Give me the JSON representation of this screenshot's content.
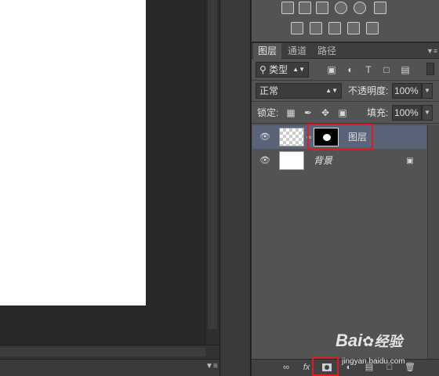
{
  "tabs": [
    {
      "label": "图层",
      "active": true
    },
    {
      "label": "通道",
      "active": false
    },
    {
      "label": "路径",
      "active": false
    }
  ],
  "filter": {
    "kind_label": "类型"
  },
  "blend": {
    "mode": "正常",
    "opacity_label": "不透明度:",
    "opacity_value": "100%"
  },
  "lock": {
    "label": "锁定:",
    "fill_label": "填充:",
    "fill_value": "100%"
  },
  "layers": [
    {
      "name": "图层",
      "visible": true,
      "selected": true,
      "has_mask": true
    },
    {
      "name": "背景",
      "visible": true,
      "selected": false,
      "locked": true
    }
  ],
  "bottom_icons": [
    "link-icon",
    "fx-icon",
    "add-mask-icon",
    "adjustment-icon",
    "group-folder-icon",
    "new-layer-icon",
    "trash-icon"
  ],
  "bottom_fx_label": "fx",
  "watermark": {
    "brand": "Bai",
    "brand_suffix": "经验",
    "url": "jingyan.baidu.com"
  },
  "colors": {
    "highlight": "#e01b24",
    "selected_row": "#5a6478",
    "panel_bg": "#535353"
  }
}
